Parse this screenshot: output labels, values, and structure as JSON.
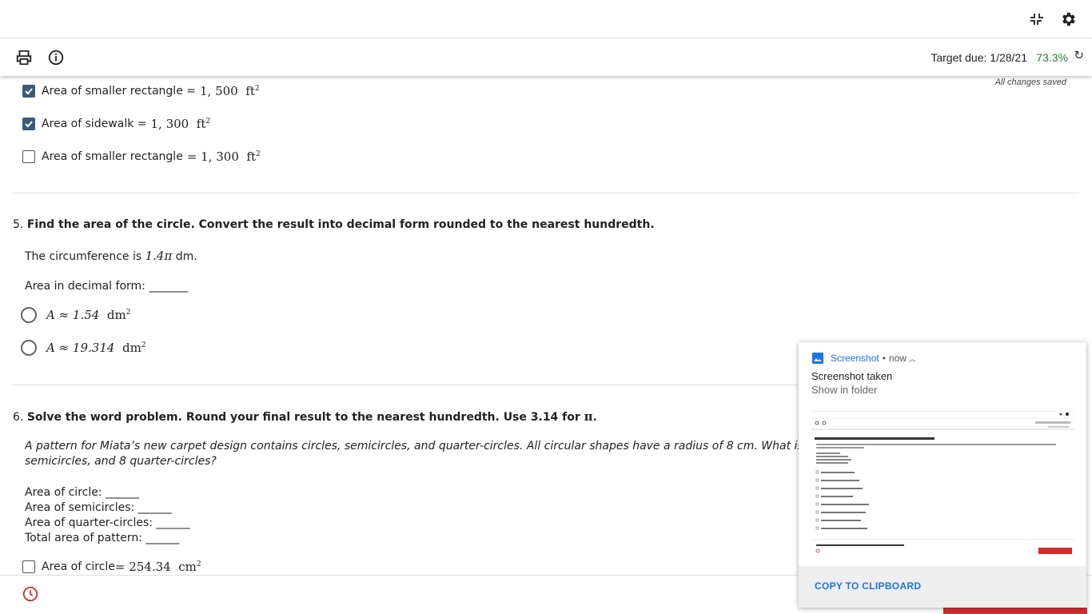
{
  "header": {
    "target_due": "Target due: 1/28/21",
    "score": "73.3%",
    "saved_status": "All changes saved"
  },
  "question4": {
    "options": [
      {
        "label": "Area of smaller rectangle = ",
        "math": "1, 500",
        "unit": "ft",
        "exp": "2",
        "checked": true
      },
      {
        "label": "Area of sidewalk = ",
        "math": "1, 300",
        "unit": "ft",
        "exp": "2",
        "checked": true
      },
      {
        "label": "Area of smaller rectangle",
        "math": "= 1, 300",
        "unit": "ft",
        "exp": "2",
        "checked": false
      }
    ]
  },
  "question5": {
    "number": "5.",
    "title": "Find the area of the circle. Convert the result into decimal form rounded to the nearest hundredth.",
    "given_text": "The circumference is ",
    "given_math": "1.4π",
    "given_unit": " dm.",
    "prompt": "Area in decimal form: _______",
    "options": [
      {
        "math": "A ≈ 1.54",
        "unit": "dm",
        "exp": "2"
      },
      {
        "math": "A ≈ 19.314",
        "unit": "dm",
        "exp": "2"
      }
    ]
  },
  "question6": {
    "number": "6.",
    "title": "Solve the word problem. Round your final result to the nearest hundredth. Use 3.14 for ",
    "title_pi": "π.",
    "problem_line1": "A pattern for Miata’s new carpet design contains circles, semicircles, and quarter-circles. All circular shapes have a radius of 8 cm. What is the a",
    "problem_line2": "semicircles, and 8 quarter-circles?",
    "blanks": [
      "Area of circle: ______",
      "Area of semicircles: ______",
      "Area of quarter-circles: ______",
      "Total area of pattern: ______"
    ],
    "first_option": {
      "label": "Area of circle",
      "math": "= 254.34",
      "unit": "cm",
      "exp": "2"
    }
  },
  "notification": {
    "app": "Screenshot",
    "separator": "•",
    "time": "now",
    "title": "Screenshot taken",
    "subtitle": "Show in folder",
    "action": "COPY TO CLIPBOARD"
  },
  "colors": {
    "accent_blue": "#1a73e8",
    "score_green": "#2e7d32",
    "checkbox_checked": "#3b5a7a",
    "clock_red": "#d32f2f"
  }
}
